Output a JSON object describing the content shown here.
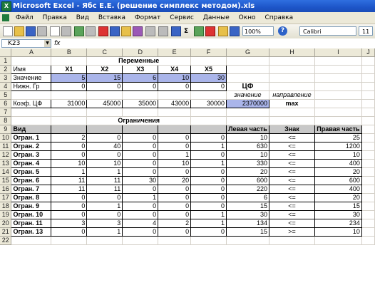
{
  "window": {
    "title": "Microsoft Excel - Ябс Е.Е. (решение симплекс методом).xls"
  },
  "menu": [
    "Файл",
    "Правка",
    "Вид",
    "Вставка",
    "Формат",
    "Сервис",
    "Данные",
    "Окно",
    "Справка"
  ],
  "toolbar": {
    "zoom": "100%",
    "font": "Calibri",
    "font_size": "11"
  },
  "formula_bar": {
    "name_box": "K23",
    "fx": "fx"
  },
  "columns": [
    "A",
    "B",
    "C",
    "D",
    "E",
    "F",
    "G",
    "H",
    "I",
    "J"
  ],
  "rows": [
    "1",
    "2",
    "3",
    "4",
    "5",
    "6",
    "7",
    "8",
    "9",
    "10",
    "11",
    "12",
    "13",
    "14",
    "15",
    "16",
    "17",
    "18",
    "19",
    "20",
    "21",
    "22"
  ],
  "sheet": {
    "vars_title": "Переменные",
    "name_label": "Имя",
    "var_names": [
      "X1",
      "X2",
      "X3",
      "X4",
      "X5"
    ],
    "value_label": "Значение",
    "values": [
      "5",
      "15",
      "6",
      "10",
      "30"
    ],
    "lower_label": "Нижн. Гр",
    "lower": [
      "0",
      "0",
      "0",
      "0",
      "0"
    ],
    "cf_label": "ЦФ",
    "cf_value_label": "значение",
    "direction_label": "направление",
    "coef_label": "Коэф. ЦФ",
    "coefs": [
      "31000",
      "45000",
      "35000",
      "43000",
      "30000"
    ],
    "cf_value": "2370000",
    "direction": "max",
    "constraints_title": "Ограничения",
    "headers": {
      "name": "Вид",
      "left": "Левая часть",
      "sign": "Знак",
      "right": "Правая часть"
    },
    "constraints": [
      {
        "name": "Огран. 1",
        "coefs": [
          "2",
          "0",
          "0",
          "0",
          "0"
        ],
        "left": "10",
        "sign": "<=",
        "right": "25"
      },
      {
        "name": "Огран. 2",
        "coefs": [
          "0",
          "40",
          "0",
          "0",
          "1"
        ],
        "left": "630",
        "sign": "<=",
        "right": "1200"
      },
      {
        "name": "Огран. 3",
        "coefs": [
          "0",
          "0",
          "0",
          "1",
          "0"
        ],
        "left": "10",
        "sign": "<=",
        "right": "10"
      },
      {
        "name": "Огран. 4",
        "coefs": [
          "10",
          "10",
          "0",
          "10",
          "1"
        ],
        "left": "330",
        "sign": "<=",
        "right": "400"
      },
      {
        "name": "Огран. 5",
        "coefs": [
          "1",
          "1",
          "0",
          "0",
          "0"
        ],
        "left": "20",
        "sign": "<=",
        "right": "20"
      },
      {
        "name": "Огран. 6",
        "coefs": [
          "11",
          "11",
          "30",
          "20",
          "0"
        ],
        "left": "600",
        "sign": "<=",
        "right": "600"
      },
      {
        "name": "Огран. 7",
        "coefs": [
          "11",
          "11",
          "0",
          "0",
          "0"
        ],
        "left": "220",
        "sign": "<=",
        "right": "400"
      },
      {
        "name": "Огран. 8",
        "coefs": [
          "0",
          "0",
          "1",
          "0",
          "0"
        ],
        "left": "6",
        "sign": "<=",
        "right": "20"
      },
      {
        "name": "Огран. 9",
        "coefs": [
          "0",
          "1",
          "0",
          "0",
          "0"
        ],
        "left": "15",
        "sign": "<=",
        "right": "15"
      },
      {
        "name": "Огран. 10",
        "coefs": [
          "0",
          "0",
          "0",
          "0",
          "1"
        ],
        "left": "30",
        "sign": "<=",
        "right": "30"
      },
      {
        "name": "Огран. 11",
        "coefs": [
          "3",
          "3",
          "4",
          "2",
          "1"
        ],
        "left": "134",
        "sign": "<=",
        "right": "234"
      },
      {
        "name": "Огран. 13",
        "coefs": [
          "0",
          "1",
          "0",
          "0",
          "0"
        ],
        "left": "15",
        "sign": ">=",
        "right": "10"
      }
    ]
  },
  "colors": {
    "highlight_blue": "#aab5ea",
    "header_gray": "#c8c8c8",
    "title_blue": "#1d55c8"
  }
}
